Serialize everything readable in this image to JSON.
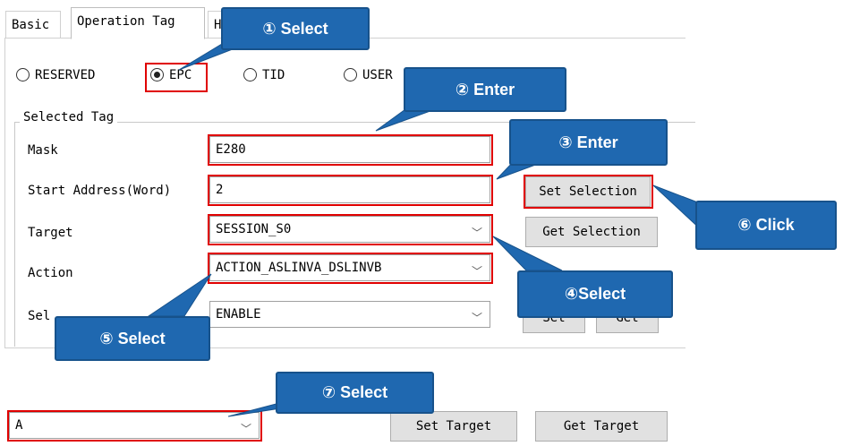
{
  "tabs": [
    {
      "label": "Basic"
    },
    {
      "label": "Operation Tag"
    },
    {
      "label": "HI"
    }
  ],
  "memory_bank": {
    "options": [
      "RESERVED",
      "EPC",
      "TID",
      "USER"
    ],
    "selected": "EPC"
  },
  "selected_tag": {
    "title": "Selected Tag",
    "mask_label": "Mask",
    "mask_value": "E280",
    "start_label": "Start Address(Word)",
    "start_value": "2",
    "target_label": "Target",
    "target_value": "SESSION_S0",
    "action_label": "Action",
    "action_value": "ACTION_ASLINVA_DSLINVB",
    "sel_label_partial": "Sel",
    "sel_value": "ENABLE",
    "set_selection": "Set Selection",
    "get_selection": "Get Selection",
    "set_btn_partial": "Set",
    "get_btn_partial": "Get"
  },
  "query_target": {
    "value": "A",
    "set_target": "Set Target",
    "get_target": "Get Target"
  },
  "callouts": {
    "c1": "① Select",
    "c2": "② Enter",
    "c3": "③ Enter",
    "c4": "④Select",
    "c5": "⑤ Select",
    "c6": "⑥ Click",
    "c7": "⑦ Select"
  },
  "colors": {
    "callout_fill": "#1f68b0",
    "highlight": "#e00000"
  },
  "icons": {
    "dropdown": "chevron-down-icon"
  }
}
